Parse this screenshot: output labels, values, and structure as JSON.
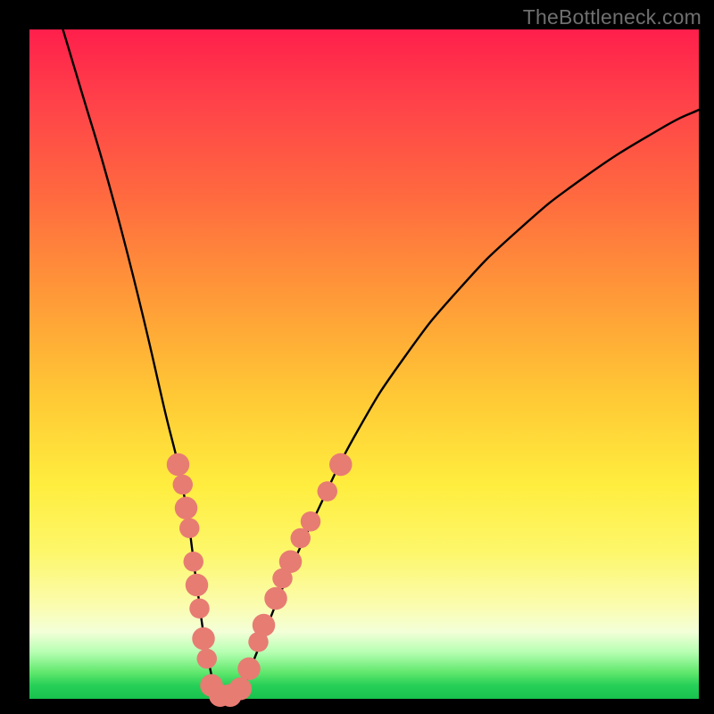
{
  "watermark": "TheBottleneck.com",
  "colors": {
    "background": "#000000",
    "gradient_top": "#ff1f4b",
    "gradient_mid": "#ffed3e",
    "gradient_bottom": "#18c24e",
    "curve": "#000000",
    "marker_fill": "#e77c73",
    "marker_stroke": "#d55f55"
  },
  "chart_data": {
    "type": "line",
    "title": "",
    "xlabel": "",
    "ylabel": "",
    "xlim": [
      0,
      100
    ],
    "ylim": [
      0,
      100
    ],
    "series": [
      {
        "name": "bottleneck-curve",
        "x": [
          5,
          8,
          11,
          14,
          17,
          20,
          23,
          25,
          26.5,
          28.5,
          31,
          34,
          38,
          43,
          49,
          56,
          64,
          73,
          83,
          94,
          100
        ],
        "y": [
          100,
          90,
          80,
          69,
          57,
          44,
          31,
          17,
          7,
          0,
          0,
          7,
          17,
          28,
          40,
          51,
          61,
          70,
          78,
          85,
          88
        ]
      }
    ],
    "markers": [
      {
        "x": 22.2,
        "y": 35.0,
        "r": 1.7
      },
      {
        "x": 22.9,
        "y": 32.0,
        "r": 1.5
      },
      {
        "x": 23.4,
        "y": 28.5,
        "r": 1.7
      },
      {
        "x": 23.9,
        "y": 25.5,
        "r": 1.5
      },
      {
        "x": 24.5,
        "y": 20.5,
        "r": 1.5
      },
      {
        "x": 25.0,
        "y": 17.0,
        "r": 1.7
      },
      {
        "x": 25.4,
        "y": 13.5,
        "r": 1.5
      },
      {
        "x": 26.0,
        "y": 9.0,
        "r": 1.7
      },
      {
        "x": 26.5,
        "y": 6.0,
        "r": 1.5
      },
      {
        "x": 27.2,
        "y": 2.0,
        "r": 1.7
      },
      {
        "x": 28.5,
        "y": 0.5,
        "r": 1.7
      },
      {
        "x": 30.0,
        "y": 0.5,
        "r": 1.7
      },
      {
        "x": 31.5,
        "y": 1.5,
        "r": 1.7
      },
      {
        "x": 32.8,
        "y": 4.5,
        "r": 1.7
      },
      {
        "x": 34.2,
        "y": 8.5,
        "r": 1.5
      },
      {
        "x": 35.0,
        "y": 11.0,
        "r": 1.7
      },
      {
        "x": 36.8,
        "y": 15.0,
        "r": 1.7
      },
      {
        "x": 37.8,
        "y": 18.0,
        "r": 1.5
      },
      {
        "x": 39.0,
        "y": 20.5,
        "r": 1.7
      },
      {
        "x": 40.5,
        "y": 24.0,
        "r": 1.5
      },
      {
        "x": 42.0,
        "y": 26.5,
        "r": 1.5
      },
      {
        "x": 44.5,
        "y": 31.0,
        "r": 1.5
      },
      {
        "x": 46.5,
        "y": 35.0,
        "r": 1.7
      }
    ]
  }
}
